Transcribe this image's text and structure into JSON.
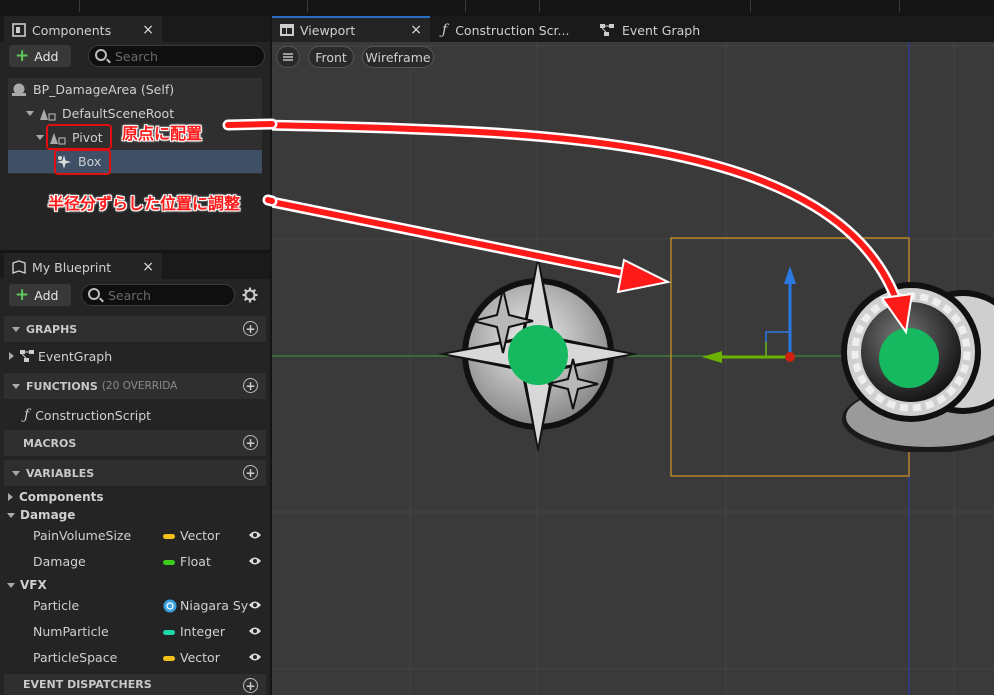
{
  "components_panel": {
    "tab_label": "Components",
    "add_label": "Add",
    "search_placeholder": "Search",
    "tree": {
      "root": "BP_DamageArea (Self)",
      "scene_root": "DefaultSceneRoot",
      "pivot": "Pivot",
      "box": "Box"
    }
  },
  "my_blueprint": {
    "tab_label": "My Blueprint",
    "add_label": "Add",
    "search_placeholder": "Search",
    "sections": {
      "graphs": "GRAPHS",
      "functions": "FUNCTIONS",
      "functions_sub": "(20 OVERRIDA",
      "macros": "MACROS",
      "variables": "VARIABLES",
      "dispatchers": "EVENT DISPATCHERS"
    },
    "graphs_items": [
      "EventGraph"
    ],
    "functions_items": [
      "ConstructionScript"
    ],
    "categories": {
      "components": "Components",
      "damage": "Damage",
      "vfx": "VFX"
    },
    "variables": [
      {
        "name": "PainVolumeSize",
        "type": "Vector",
        "color": "#f2c018"
      },
      {
        "name": "Damage",
        "type": "Float",
        "color": "#3ccc1e"
      },
      {
        "name": "Particle",
        "type": "Niagara Sy",
        "color": "#3aa0e0"
      },
      {
        "name": "NumParticle",
        "type": "Integer",
        "color": "#1ed7a8"
      },
      {
        "name": "ParticleSpace",
        "type": "Vector",
        "color": "#f2c018"
      }
    ]
  },
  "editor_tabs": {
    "viewport": "Viewport",
    "construction": "Construction Scr...",
    "event_graph": "Event Graph"
  },
  "viewport": {
    "view_mode": "Front",
    "render_mode": "Wireframe"
  },
  "annotations": {
    "origin_note": "原点に配置",
    "offset_note": "半径分ずらした位置に調整"
  },
  "colors": {
    "accent_red": "#ff1a1a",
    "bounds_orange": "#d8961e",
    "marker_green": "#16b860"
  }
}
